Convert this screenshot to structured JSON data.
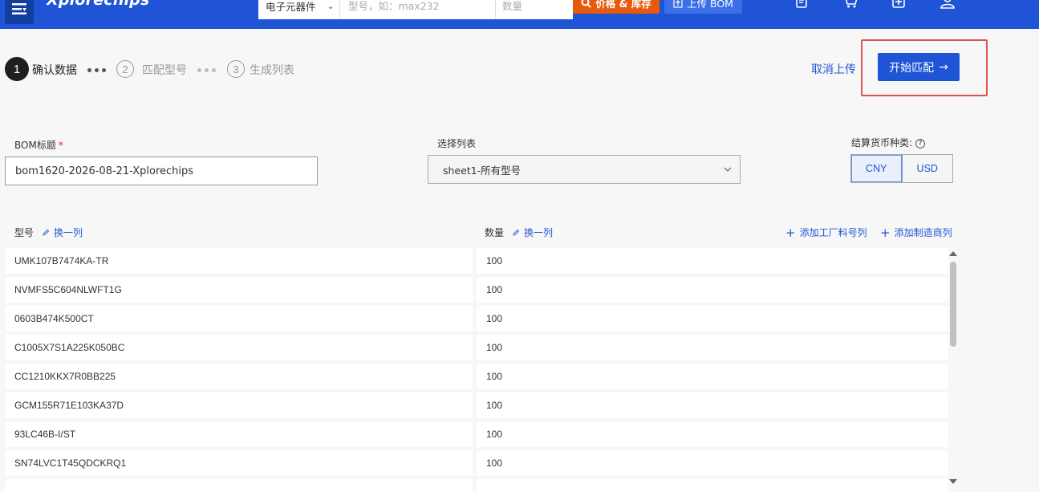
{
  "header": {
    "logo": "Xplorechips",
    "search": {
      "category": "电子元器件",
      "placeholder": "型号，如：max232",
      "qty_placeholder": "数量"
    },
    "price_button": "价格 & 库存",
    "upload_button": "上传 BOM",
    "icons": [
      "menu-icon",
      "quote-icon",
      "cart-icon",
      "add-icon",
      "user-icon"
    ]
  },
  "steps": [
    {
      "num": "1",
      "label": "确认数据",
      "active": true
    },
    {
      "num": "2",
      "label": "匹配型号",
      "active": false
    },
    {
      "num": "3",
      "label": "生成列表",
      "active": false
    }
  ],
  "actions": {
    "cancel": "取消上传",
    "start": "开始匹配",
    "start_arrow": "→"
  },
  "form": {
    "bom_title_label": "BOM标题",
    "required_mark": "*",
    "bom_title_value": "bom1620-2026-08-21-Xplorechips",
    "list_label": "选择列表",
    "list_value": "sheet1-所有型号",
    "currency_label": "结算货币种类:",
    "currency_help": "?",
    "currency_options": [
      "CNY",
      "USD"
    ],
    "currency_selected": "CNY"
  },
  "table": {
    "part_header": "型号",
    "qty_header": "数量",
    "swap_label": "换一列",
    "add_factory_col": "添加工厂料号列",
    "add_mfr_col": "添加制造商列",
    "rows": [
      {
        "part": "UMK107B7474KA-TR",
        "qty": "100"
      },
      {
        "part": "NVMFS5C604NLWFT1G",
        "qty": "100"
      },
      {
        "part": "0603B474K500CT",
        "qty": "100"
      },
      {
        "part": "C1005X7S1A225K050BC",
        "qty": "100"
      },
      {
        "part": "CC1210KKX7R0BB225",
        "qty": "100"
      },
      {
        "part": "GCM155R71E103KA37D",
        "qty": "100"
      },
      {
        "part": "93LC46B-I/ST",
        "qty": "100"
      },
      {
        "part": "SN74LVC1T45QDCKRQ1",
        "qty": "100"
      }
    ]
  },
  "colors": {
    "brand": "#1f54d6",
    "price_button": "#e8590c",
    "highlight": "#e05252"
  }
}
